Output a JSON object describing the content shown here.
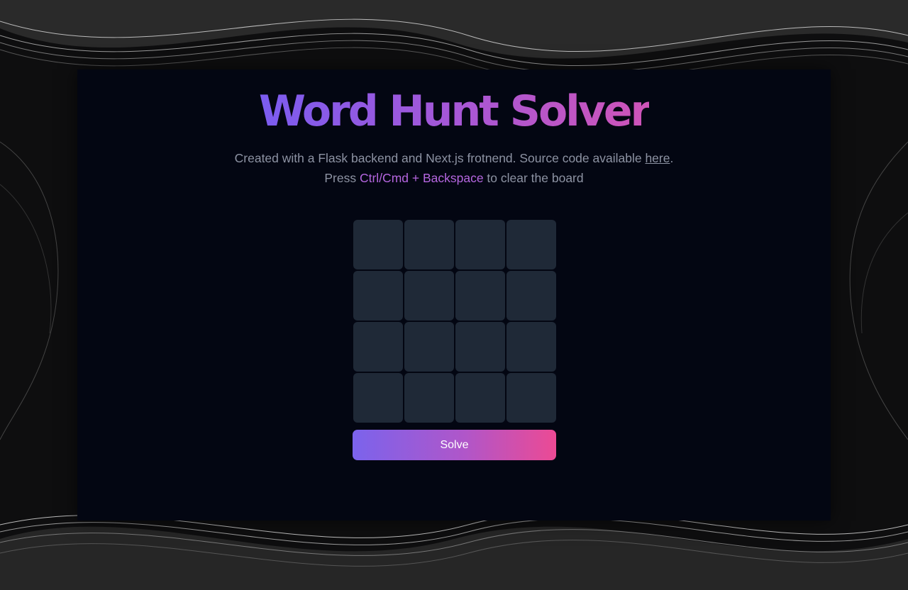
{
  "header": {
    "title": "Word Hunt Solver"
  },
  "intro": {
    "text_before_link": "Created with a Flask backend and Next.js frotnend. Source code available ",
    "link_label": "here",
    "text_after_link": ". Press ",
    "shortcut": "Ctrl/Cmd + Backspace",
    "text_end": " to clear the board"
  },
  "board": {
    "rows": 4,
    "cols": 4,
    "cells": [
      "",
      "",
      "",
      "",
      "",
      "",
      "",
      "",
      "",
      "",
      "",
      "",
      "",
      "",
      "",
      ""
    ]
  },
  "actions": {
    "solve_label": "Solve"
  },
  "colors": {
    "panel": "#030612",
    "cell": "#1f2937",
    "accent_start": "#7b63ec",
    "accent_end": "#ec4a94",
    "muted_text": "#8d93a3"
  }
}
